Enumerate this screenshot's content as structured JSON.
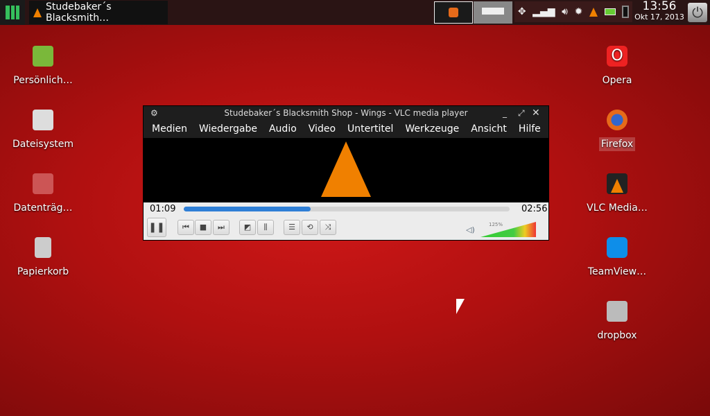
{
  "panel": {
    "task_title": "Studebaker´s Blacksmith…",
    "time": "13:56",
    "date": "Okt 17, 2013"
  },
  "desktop_left": [
    {
      "label": "Persönlich…",
      "icon": "home-folder-icon"
    },
    {
      "label": "Dateisystem",
      "icon": "drive-icon"
    },
    {
      "label": "Datenträg…",
      "icon": "removable-drive-icon"
    },
    {
      "label": "Papierkorb",
      "icon": "trash-icon"
    }
  ],
  "desktop_right": [
    {
      "label": "Opera",
      "icon": "opera-icon"
    },
    {
      "label": "Firefox",
      "icon": "firefox-icon"
    },
    {
      "label": "VLC Media…",
      "icon": "vlc-icon"
    },
    {
      "label": "TeamView…",
      "icon": "teamviewer-icon"
    },
    {
      "label": "dropbox",
      "icon": "dropbox-icon"
    }
  ],
  "vlc": {
    "title": "Studebaker´s Blacksmith Shop - Wings - VLC media player",
    "menu": [
      "Medien",
      "Wiedergabe",
      "Audio",
      "Video",
      "Untertitel",
      "Werkzeuge",
      "Ansicht",
      "Hilfe"
    ],
    "elapsed": "01:09",
    "total": "02:56",
    "progress": 0.39,
    "volume_label": "125%",
    "volume": 1.25
  },
  "colors": {
    "accent": "#2f7fd6"
  }
}
